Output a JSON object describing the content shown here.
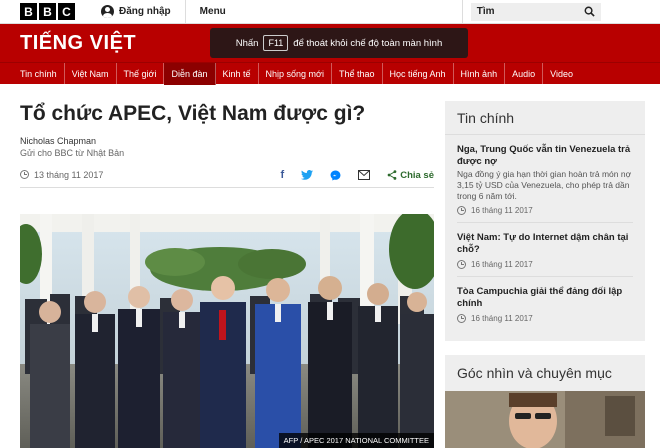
{
  "topbar": {
    "logo_letters": [
      "B",
      "B",
      "C"
    ],
    "signin_label": "Đăng nhập",
    "menu_label": "Menu",
    "search_placeholder": "Tìm"
  },
  "masthead": {
    "brand": "TIẾNG VIỆT",
    "fullscreen_notice": {
      "before": "Nhấn",
      "key": "F11",
      "after": "để thoát khỏi chế độ toàn màn hình"
    }
  },
  "nav": {
    "items": [
      "Tin chính",
      "Việt Nam",
      "Thế giới",
      "Diễn đàn",
      "Kinh tế",
      "Nhịp sống mới",
      "Thể thao",
      "Học tiếng Anh",
      "Hình ảnh",
      "Audio",
      "Video"
    ],
    "active": "Diễn đàn"
  },
  "article": {
    "headline": "Tổ chức APEC, Việt Nam được gì?",
    "author": "Nicholas Chapman",
    "author_role": "Gửi cho BBC từ Nhật Bản",
    "date": "13 tháng 11 2017",
    "share_label": "Chia sẻ",
    "photo_credit": "AFP / APEC 2017 NATIONAL COMMITTEE"
  },
  "sidebar": {
    "heading": "Tin chính",
    "items": [
      {
        "title": "Nga, Trung Quốc vẫn tin Venezuela trả được nợ",
        "summary": "Nga đồng ý gia hạn thời gian hoàn trả món nợ 3,15 tỷ USD của Venezuela, cho phép trả dần trong 6 năm tới.",
        "date": "16 tháng 11 2017"
      },
      {
        "title": "Việt Nam: Tự do Internet dậm chân tại chỗ?",
        "summary": "",
        "date": "16 tháng 11 2017"
      },
      {
        "title": "Tòa Campuchia giải thể đảng đối lập chính",
        "summary": "",
        "date": "16 tháng 11 2017"
      }
    ],
    "opinion_heading": "Góc nhìn và chuyên mục"
  },
  "colors": {
    "bbc_red": "#b80000",
    "nav_active": "#8c0000",
    "share_green": "#2d6a2d",
    "sidebar_bg": "#eeeeee"
  }
}
